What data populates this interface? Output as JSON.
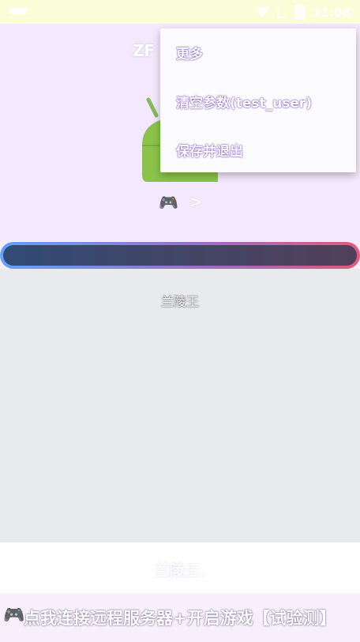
{
  "status": {
    "time": "11:08"
  },
  "app": {
    "title": "ZF"
  },
  "main": {
    "label": "兰陵王"
  },
  "bottom": {
    "field_text": "兰陵王.",
    "footer_text": "点我连接远程服务器+开启游戏【试验测】"
  },
  "menu": {
    "items": [
      "更多",
      "清空参数(test_user)",
      "保存并退出"
    ]
  }
}
